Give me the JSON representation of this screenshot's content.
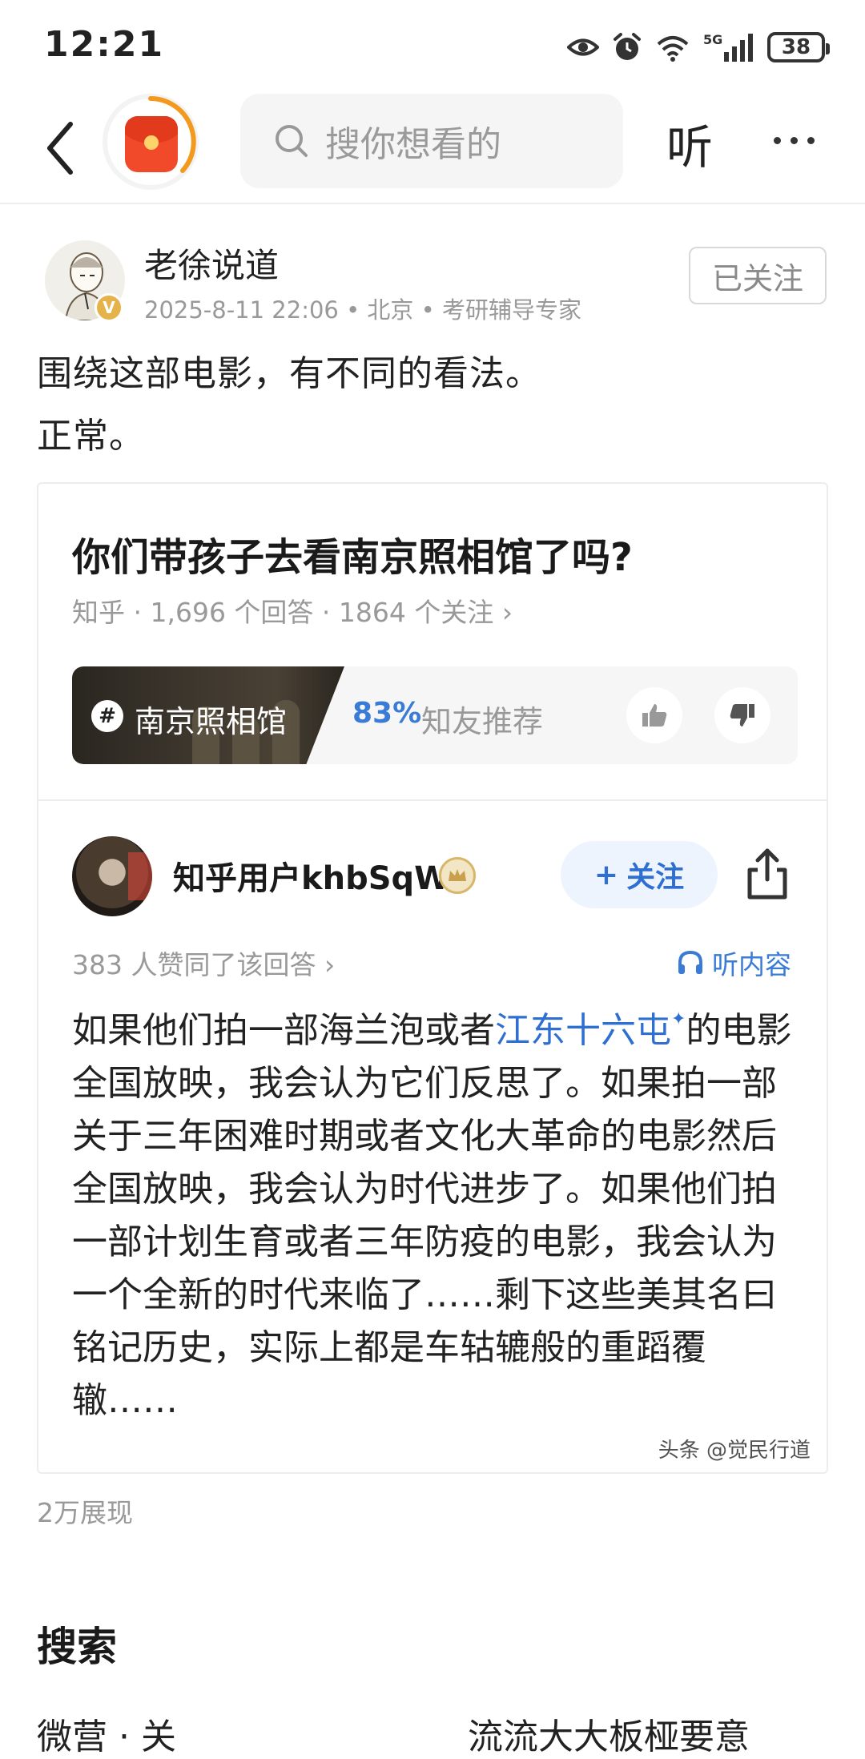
{
  "status_bar": {
    "time": "12:21",
    "network": "5G",
    "battery": "38"
  },
  "nav": {
    "search_placeholder": "搜你想看的",
    "listen_label": "听"
  },
  "post": {
    "author_name": "老徐说道",
    "author_meta": "2025-8-11 22:06 • 北京 • 考研辅导专家",
    "follow_label": "已关注",
    "verify_label": "V",
    "text_lines": [
      "围绕这部电影，有不同的看法。",
      "正常。"
    ],
    "view_count": "2万展现"
  },
  "card": {
    "question": "你们带孩子去看南京照相馆了吗?",
    "question_meta": "知乎 · 1,696 个回答 · 1864 个关注 ›",
    "topic_hash": "#",
    "topic_name": "南京照相馆",
    "recommend_percent": "83%",
    "recommend_label": "知友推荐",
    "answer": {
      "author": "知乎用户khbSqW",
      "follow_label": "关注",
      "likes_text": "383 人赞同了该回答 ›",
      "listen_label": "听内容",
      "body_start": "如果他们拍一部海兰泡或者",
      "body_link": "江东十六屯",
      "body_rest": "的电影全国放映，我会认为它们反思了。如果拍一部关于三年困难时期或者文化大革命的电影然后全国放映，我会认为时代进步了。如果他们拍一部计划生育或者三年防疫的电影，我会认为一个全新的时代来临了……剩下这些美其名曰铭记历史，实际上都是车轱辘般的重蹈覆辙……"
    },
    "watermark": "头条 @觉民行道"
  },
  "search_section": {
    "title": "搜索",
    "suggest_left": "微营 · 关",
    "suggest_right": "流流大大板桠要意"
  },
  "colors": {
    "accent_blue": "#2f6fd1",
    "red_packet": "#f04a2a",
    "ring_orange": "#f39a1e"
  }
}
